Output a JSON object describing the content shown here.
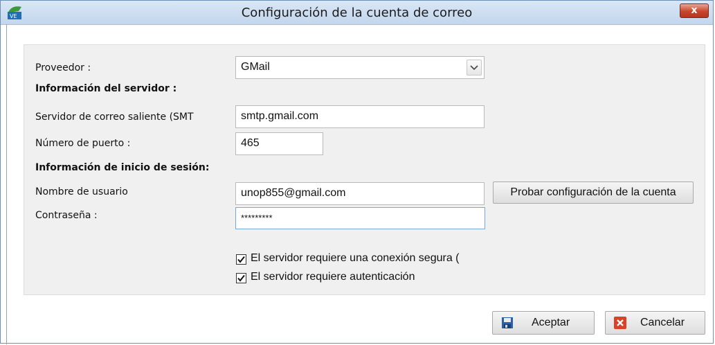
{
  "window": {
    "title": "Configuración de la cuenta de correo",
    "close_label": "x"
  },
  "form": {
    "provider_label": "Proveedor :",
    "provider_value": "GMail",
    "server_info_heading": "Información del servidor :",
    "smtp_label": "Servidor de correo saliente  (SMT",
    "smtp_value": "smtp.gmail.com",
    "port_label": "Número de puerto :",
    "port_value": "465",
    "login_heading": "Información de inicio de sesión:",
    "username_label": "Nombre de usuario",
    "username_value": "unop855@gmail.com",
    "test_button": "Probar configuración de la cuenta",
    "password_label": "Contraseña :",
    "password_value": "*********",
    "secure_label": "El servidor requiere una conexión segura (",
    "secure_checked": true,
    "auth_label": "El servidor requiere autenticación",
    "auth_checked": true
  },
  "footer": {
    "accept_label": "Aceptar",
    "cancel_label": "Cancelar"
  },
  "colors": {
    "titlebar": "#c9dbef",
    "close": "#c7462c",
    "panel": "#f0f0f0"
  }
}
